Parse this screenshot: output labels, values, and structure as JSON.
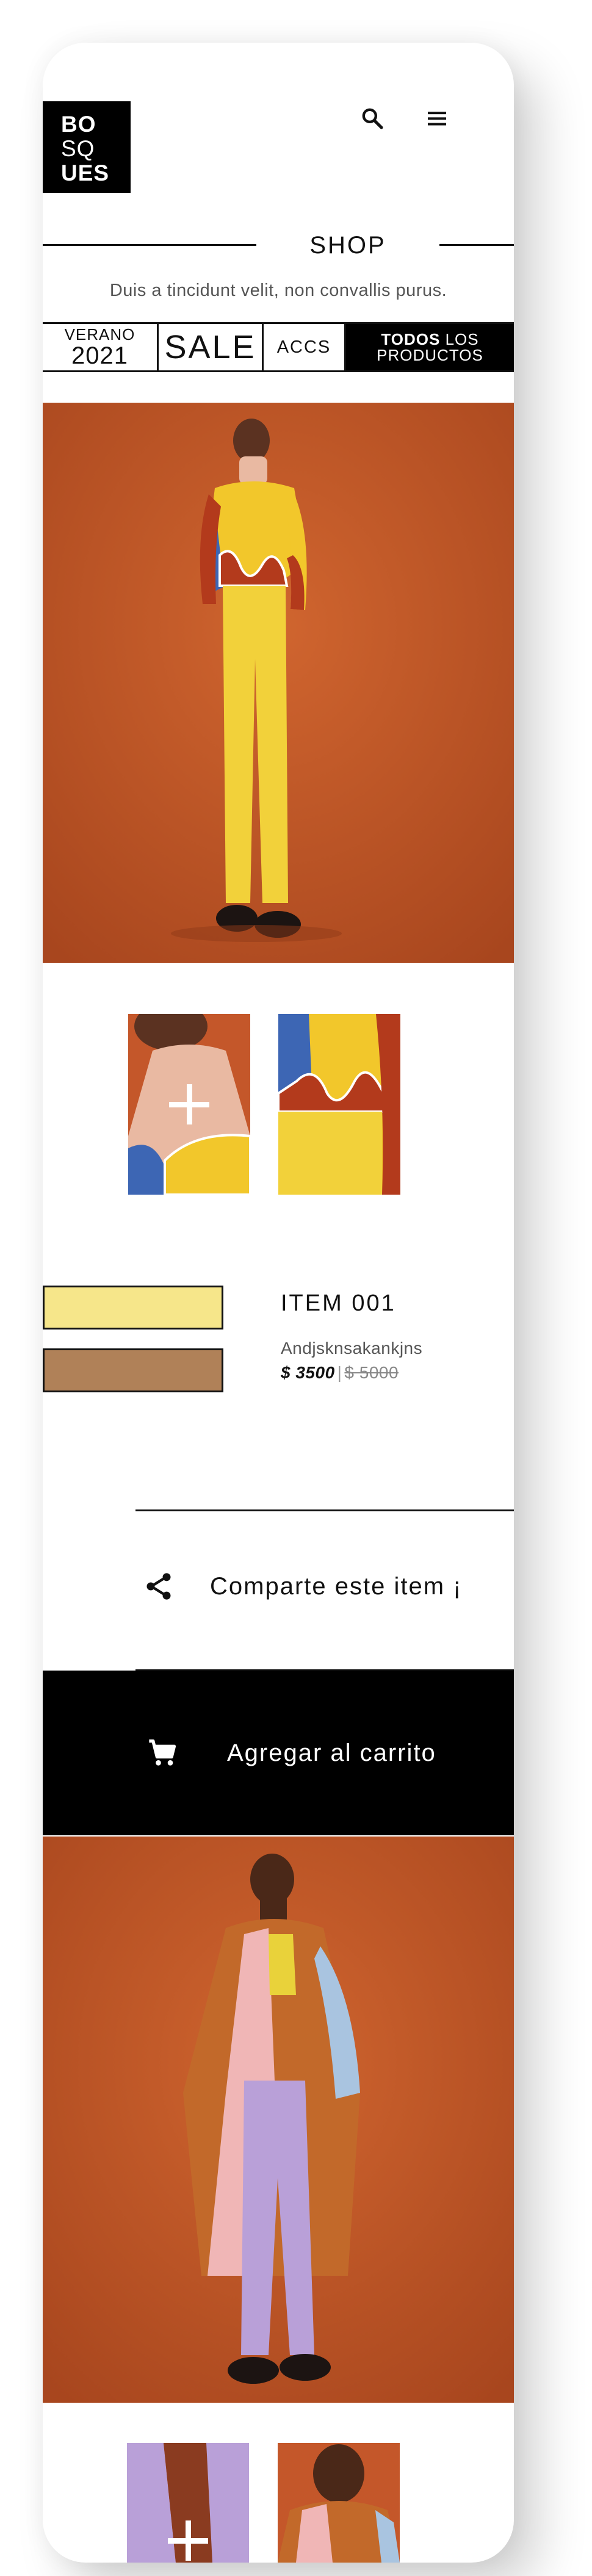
{
  "header": {
    "logo": {
      "line1": "BO",
      "line2": "SQ",
      "line3": "UES"
    },
    "search_icon": "search-icon",
    "menu_icon": "menu-icon"
  },
  "shop": {
    "title": "SHOP",
    "subtitle": "Duis a tincidunt velit, non convallis purus."
  },
  "categories": {
    "verano_line1": "VERANO",
    "verano_line2": "2021",
    "sale": "SALE",
    "accs": "ACCS",
    "todos_bold": "TODOS",
    "todos_rest": "LOS",
    "todos_line2": "PRODUCTOS"
  },
  "item": {
    "title": "ITEM 001",
    "subtitle": "Andjsknsakankjns",
    "price": "$ 3500",
    "price_separator": "|",
    "old_price": "$ 5000",
    "swatches": [
      "#f6e68a",
      "#b08158"
    ]
  },
  "actions": {
    "share_label": "Comparte este item ¡",
    "share_icon": "share-icon",
    "cart_label": "Agregar al carrito",
    "cart_icon": "shopping-cart-icon"
  },
  "colors": {
    "background_orange": "#c2582a",
    "black": "#000000",
    "swatch_yellow": "#f6e68a",
    "swatch_tan": "#b08158"
  }
}
